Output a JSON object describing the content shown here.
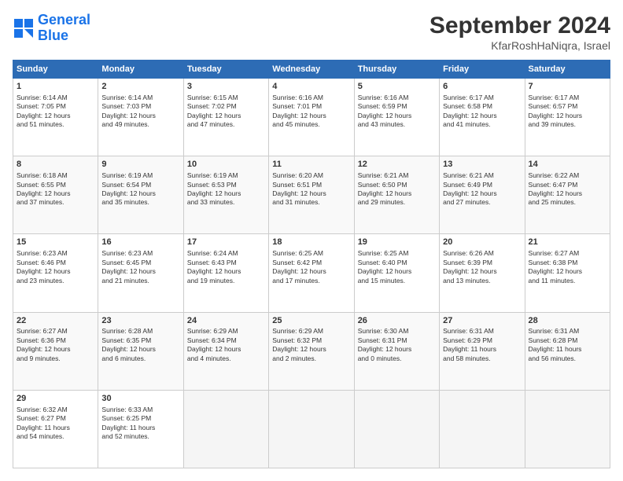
{
  "header": {
    "logo_line1": "General",
    "logo_line2": "Blue",
    "title": "September 2024",
    "subtitle": "KfarRoshHaNiqra, Israel"
  },
  "days_of_week": [
    "Sunday",
    "Monday",
    "Tuesday",
    "Wednesday",
    "Thursday",
    "Friday",
    "Saturday"
  ],
  "weeks": [
    [
      {
        "num": "1",
        "info": "Sunrise: 6:14 AM\nSunset: 7:05 PM\nDaylight: 12 hours\nand 51 minutes."
      },
      {
        "num": "2",
        "info": "Sunrise: 6:14 AM\nSunset: 7:03 PM\nDaylight: 12 hours\nand 49 minutes."
      },
      {
        "num": "3",
        "info": "Sunrise: 6:15 AM\nSunset: 7:02 PM\nDaylight: 12 hours\nand 47 minutes."
      },
      {
        "num": "4",
        "info": "Sunrise: 6:16 AM\nSunset: 7:01 PM\nDaylight: 12 hours\nand 45 minutes."
      },
      {
        "num": "5",
        "info": "Sunrise: 6:16 AM\nSunset: 6:59 PM\nDaylight: 12 hours\nand 43 minutes."
      },
      {
        "num": "6",
        "info": "Sunrise: 6:17 AM\nSunset: 6:58 PM\nDaylight: 12 hours\nand 41 minutes."
      },
      {
        "num": "7",
        "info": "Sunrise: 6:17 AM\nSunset: 6:57 PM\nDaylight: 12 hours\nand 39 minutes."
      }
    ],
    [
      {
        "num": "8",
        "info": "Sunrise: 6:18 AM\nSunset: 6:55 PM\nDaylight: 12 hours\nand 37 minutes."
      },
      {
        "num": "9",
        "info": "Sunrise: 6:19 AM\nSunset: 6:54 PM\nDaylight: 12 hours\nand 35 minutes."
      },
      {
        "num": "10",
        "info": "Sunrise: 6:19 AM\nSunset: 6:53 PM\nDaylight: 12 hours\nand 33 minutes."
      },
      {
        "num": "11",
        "info": "Sunrise: 6:20 AM\nSunset: 6:51 PM\nDaylight: 12 hours\nand 31 minutes."
      },
      {
        "num": "12",
        "info": "Sunrise: 6:21 AM\nSunset: 6:50 PM\nDaylight: 12 hours\nand 29 minutes."
      },
      {
        "num": "13",
        "info": "Sunrise: 6:21 AM\nSunset: 6:49 PM\nDaylight: 12 hours\nand 27 minutes."
      },
      {
        "num": "14",
        "info": "Sunrise: 6:22 AM\nSunset: 6:47 PM\nDaylight: 12 hours\nand 25 minutes."
      }
    ],
    [
      {
        "num": "15",
        "info": "Sunrise: 6:23 AM\nSunset: 6:46 PM\nDaylight: 12 hours\nand 23 minutes."
      },
      {
        "num": "16",
        "info": "Sunrise: 6:23 AM\nSunset: 6:45 PM\nDaylight: 12 hours\nand 21 minutes."
      },
      {
        "num": "17",
        "info": "Sunrise: 6:24 AM\nSunset: 6:43 PM\nDaylight: 12 hours\nand 19 minutes."
      },
      {
        "num": "18",
        "info": "Sunrise: 6:25 AM\nSunset: 6:42 PM\nDaylight: 12 hours\nand 17 minutes."
      },
      {
        "num": "19",
        "info": "Sunrise: 6:25 AM\nSunset: 6:40 PM\nDaylight: 12 hours\nand 15 minutes."
      },
      {
        "num": "20",
        "info": "Sunrise: 6:26 AM\nSunset: 6:39 PM\nDaylight: 12 hours\nand 13 minutes."
      },
      {
        "num": "21",
        "info": "Sunrise: 6:27 AM\nSunset: 6:38 PM\nDaylight: 12 hours\nand 11 minutes."
      }
    ],
    [
      {
        "num": "22",
        "info": "Sunrise: 6:27 AM\nSunset: 6:36 PM\nDaylight: 12 hours\nand 9 minutes."
      },
      {
        "num": "23",
        "info": "Sunrise: 6:28 AM\nSunset: 6:35 PM\nDaylight: 12 hours\nand 6 minutes."
      },
      {
        "num": "24",
        "info": "Sunrise: 6:29 AM\nSunset: 6:34 PM\nDaylight: 12 hours\nand 4 minutes."
      },
      {
        "num": "25",
        "info": "Sunrise: 6:29 AM\nSunset: 6:32 PM\nDaylight: 12 hours\nand 2 minutes."
      },
      {
        "num": "26",
        "info": "Sunrise: 6:30 AM\nSunset: 6:31 PM\nDaylight: 12 hours\nand 0 minutes."
      },
      {
        "num": "27",
        "info": "Sunrise: 6:31 AM\nSunset: 6:29 PM\nDaylight: 11 hours\nand 58 minutes."
      },
      {
        "num": "28",
        "info": "Sunrise: 6:31 AM\nSunset: 6:28 PM\nDaylight: 11 hours\nand 56 minutes."
      }
    ],
    [
      {
        "num": "29",
        "info": "Sunrise: 6:32 AM\nSunset: 6:27 PM\nDaylight: 11 hours\nand 54 minutes."
      },
      {
        "num": "30",
        "info": "Sunrise: 6:33 AM\nSunset: 6:25 PM\nDaylight: 11 hours\nand 52 minutes."
      },
      {
        "num": "",
        "info": ""
      },
      {
        "num": "",
        "info": ""
      },
      {
        "num": "",
        "info": ""
      },
      {
        "num": "",
        "info": ""
      },
      {
        "num": "",
        "info": ""
      }
    ]
  ]
}
